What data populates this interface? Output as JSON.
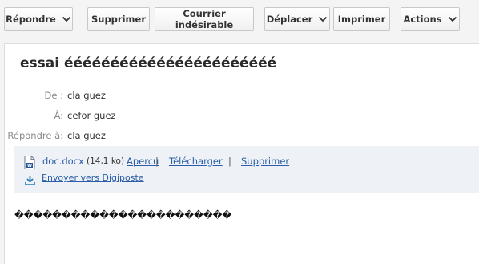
{
  "toolbar": {
    "reply_label": "Répondre",
    "delete_label": "Supprimer",
    "spam_label": "Courrier indésirable",
    "move_label": "Déplacer",
    "print_label": "Imprimer",
    "actions_label": "Actions"
  },
  "message": {
    "subject": "essai ééééééééééééééééééééééé",
    "from_label": "De :",
    "from_value": "cla guez",
    "to_label": "À:",
    "to_value": "cefor guez",
    "reply_to_label": "Répondre à:",
    "reply_to_value": "cla guez"
  },
  "attachment": {
    "file_name": "doc.docx",
    "file_size": "(14,1 ko)",
    "preview_label": "Apercu",
    "download_label": "Télécharger",
    "delete_label": "Supprimer",
    "send_label": "Envoyer vers Digiposte",
    "separator": "|"
  },
  "body": {
    "text": "�����������������������"
  },
  "colors": {
    "link": "#2a5ea8",
    "attachment_bg": "#eef1f5",
    "toolbar_bg": "#f4f4f4"
  }
}
